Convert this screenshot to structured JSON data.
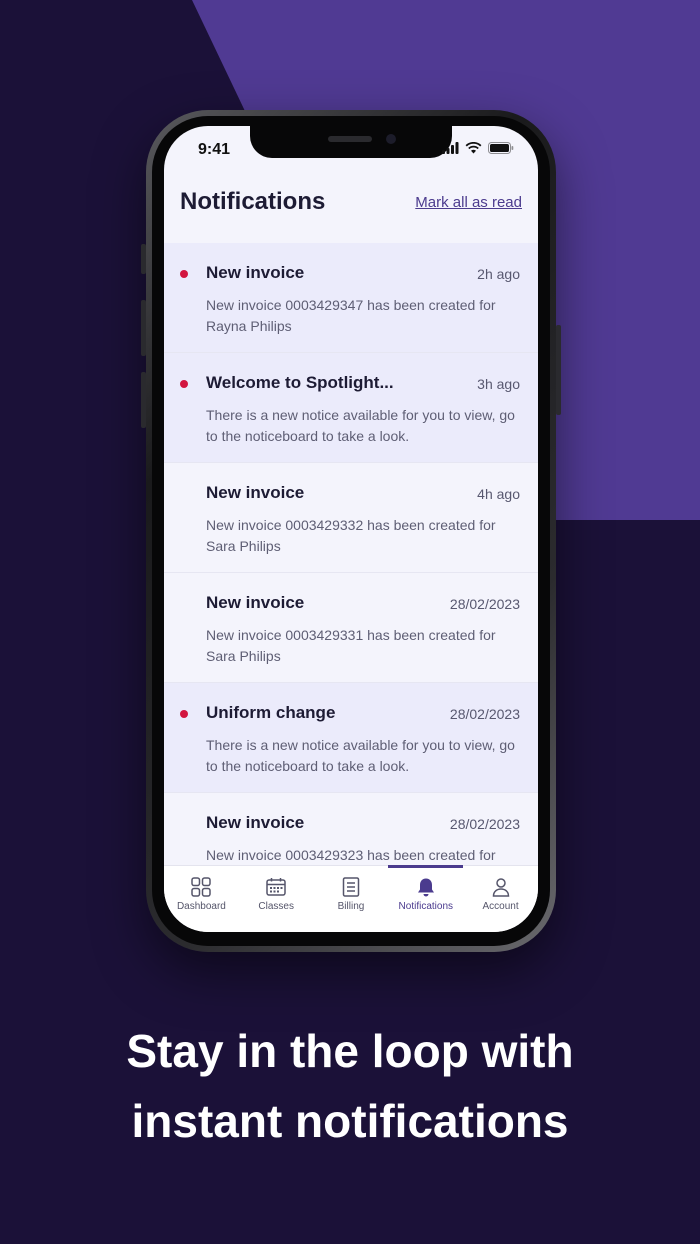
{
  "status_bar": {
    "time": "9:41"
  },
  "header": {
    "title": "Notifications",
    "mark_all_label": "Mark all as read"
  },
  "notifications": [
    {
      "title": "New invoice",
      "time": "2h ago",
      "body": "New invoice 0003429347 has been created for Rayna Philips",
      "unread": true
    },
    {
      "title": "Welcome to Spotlight...",
      "time": "3h ago",
      "body": "There is a new notice available for you to view, go to the noticeboard to take a look.",
      "unread": true
    },
    {
      "title": "New invoice",
      "time": "4h ago",
      "body": "New invoice 0003429332 has been created for Sara Philips",
      "unread": false
    },
    {
      "title": "New invoice",
      "time": "28/02/2023",
      "body": "New invoice 0003429331 has been created for Sara Philips",
      "unread": false
    },
    {
      "title": "Uniform change",
      "time": "28/02/2023",
      "body": "There is a new notice available for you to view, go to the noticeboard to take a look.",
      "unread": true
    },
    {
      "title": "New invoice",
      "time": "28/02/2023",
      "body": "New invoice 0003429323 has been created for",
      "unread": false
    }
  ],
  "tabs": [
    {
      "label": "Dashboard",
      "icon": "grid-icon"
    },
    {
      "label": "Classes",
      "icon": "calendar-icon"
    },
    {
      "label": "Billing",
      "icon": "document-icon"
    },
    {
      "label": "Notifications",
      "icon": "bell-icon",
      "active": true
    },
    {
      "label": "Account",
      "icon": "person-icon"
    }
  ],
  "caption": {
    "line1": "Stay in the loop with",
    "line2": "instant notifications"
  },
  "colors": {
    "background": "#1b1138",
    "accent_shape": "#503a93",
    "accent": "#4b3b8e",
    "unread_dot": "#d2153f",
    "unread_row": "#ebebfb"
  }
}
